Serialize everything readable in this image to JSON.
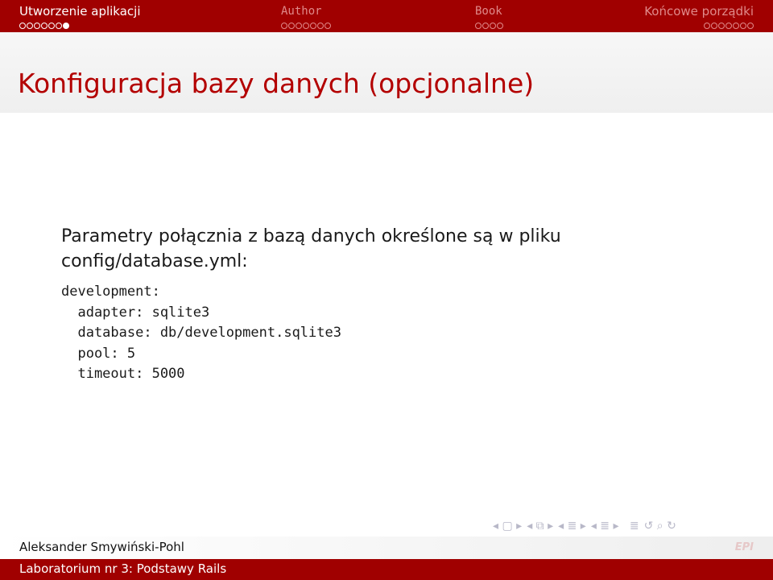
{
  "nav": {
    "sections": [
      {
        "name": "Utworzenie aplikacji",
        "dots": 7,
        "filled_index": 6,
        "state": "active"
      },
      {
        "name": "Author",
        "dots": 7,
        "filled_index": -1,
        "state": "inactive"
      },
      {
        "name": "Book",
        "dots": 4,
        "filled_index": -1,
        "state": "inactive"
      },
      {
        "name": "Końcowe porządki",
        "dots": 7,
        "filled_index": -1,
        "state": "right"
      }
    ]
  },
  "frame": {
    "title": "Konfiguracja bazy danych (opcjonalne)"
  },
  "content": {
    "paragraph_line1": "Parametry połącznia z bazą danych określone są w pliku",
    "paragraph_line2": "config/database.yml:",
    "code_lines": [
      "development:",
      "  adapter: sqlite3",
      "  database: db/development.sqlite3",
      "  pool: 5",
      "  timeout: 5000"
    ]
  },
  "footer": {
    "author": "Aleksander Smywiński-Pohl",
    "course": "Laboratorium nr 3: Podstawy Rails",
    "logo_text": "EPI"
  },
  "beamer_nav_icons": [
    "nav-frame-icon",
    "nav-subsection-icon",
    "nav-section-icon",
    "nav-doc-icon",
    "nav-search-icon"
  ],
  "colors": {
    "accent": "#a00000",
    "title": "#b30000"
  }
}
